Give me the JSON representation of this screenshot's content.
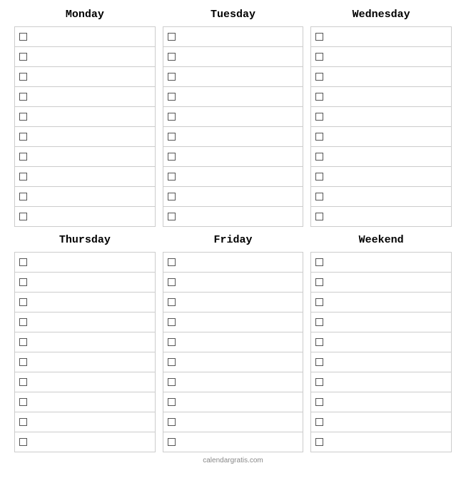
{
  "days": [
    {
      "label": "Monday",
      "tasks": [
        "",
        "",
        "",
        "",
        "",
        "",
        "",
        "",
        "",
        ""
      ]
    },
    {
      "label": "Tuesday",
      "tasks": [
        "",
        "",
        "",
        "",
        "",
        "",
        "",
        "",
        "",
        ""
      ]
    },
    {
      "label": "Wednesday",
      "tasks": [
        "",
        "",
        "",
        "",
        "",
        "",
        "",
        "",
        "",
        ""
      ]
    },
    {
      "label": "Thursday",
      "tasks": [
        "",
        "",
        "",
        "",
        "",
        "",
        "",
        "",
        "",
        ""
      ]
    },
    {
      "label": "Friday",
      "tasks": [
        "",
        "",
        "",
        "",
        "",
        "",
        "",
        "",
        "",
        ""
      ]
    },
    {
      "label": "Weekend",
      "tasks": [
        "",
        "",
        "",
        "",
        "",
        "",
        "",
        "",
        "",
        ""
      ]
    }
  ],
  "footer": "calendargratis.com"
}
